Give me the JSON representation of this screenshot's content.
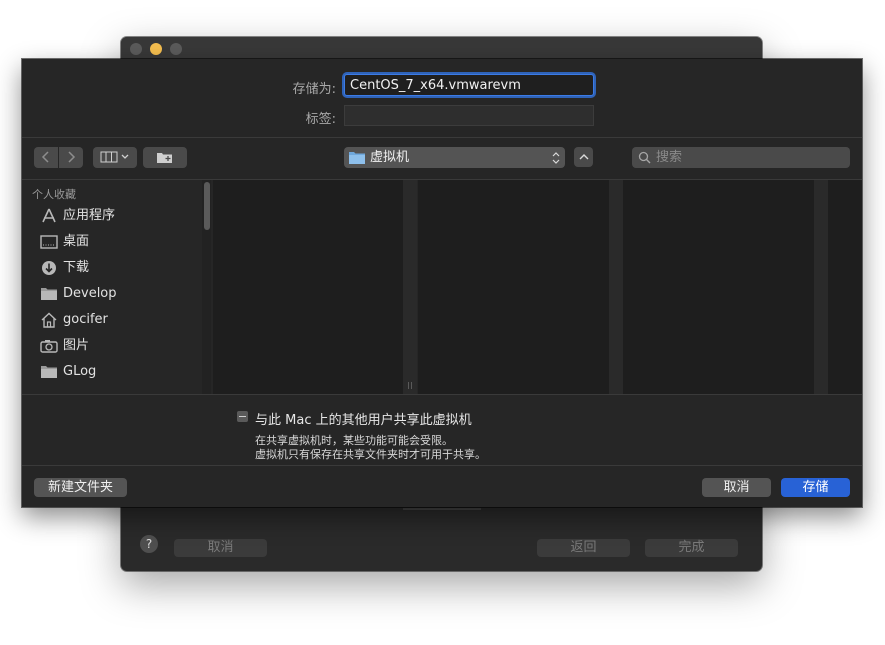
{
  "parent_window": {
    "help_label": "?",
    "cancel_label": "取消",
    "back_label": "返回",
    "done_label": "完成"
  },
  "save_sheet": {
    "save_as_label": "存储为:",
    "filename_value": "CentOS_7_x64.vmwarevm",
    "tags_label": "标签:",
    "tags_value": "",
    "location_name": "虚拟机",
    "search_placeholder": "搜索",
    "sidebar": {
      "heading": "个人收藏",
      "items": [
        {
          "label": "应用程序",
          "icon": "applications-icon"
        },
        {
          "label": "桌面",
          "icon": "desktop-icon"
        },
        {
          "label": "下载",
          "icon": "downloads-icon"
        },
        {
          "label": "Develop",
          "icon": "folder-icon"
        },
        {
          "label": "gocifer",
          "icon": "home-icon"
        },
        {
          "label": "图片",
          "icon": "pictures-icon"
        },
        {
          "label": "GLog",
          "icon": "folder-icon"
        }
      ]
    },
    "share_option": {
      "label": "与此 Mac 上的其他用户共享此虚拟机",
      "checked": false,
      "note_line1": "在共享虚拟机时，某些功能可能会受限。",
      "note_line2": "虚拟机只有保存在共享文件夹时才可用于共享。"
    },
    "new_folder_label": "新建文件夹",
    "cancel_label": "取消",
    "save_label": "存储"
  },
  "colors": {
    "accent": "#2862d6",
    "traffic_minimize": "#f5be4f"
  }
}
